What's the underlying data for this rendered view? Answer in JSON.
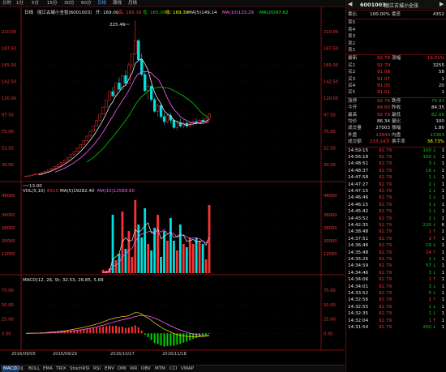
{
  "tabs": [
    "分时",
    "1分",
    "5分",
    "15分",
    "30分",
    "60分",
    "日线",
    "周线",
    "月线"
  ],
  "active_tab": "日线",
  "price_header": {
    "period": "日线",
    "name": "丽江古城小全张(6001003)",
    "open": "开: 169.00",
    "high": "高: 169.39",
    "low": "低: 165.00",
    "close": "收: 169.39",
    "ma5": "MA(5)149.14",
    "ma10": "MA(10)133.29",
    "ma20": "MA(20)97.62"
  },
  "vol_header": {
    "label": "VOL(5,10)",
    "v": "8510",
    "ma5": "MA(5)19282.40",
    "ma10": "MA(10)12589.60"
  },
  "macd_header": {
    "label": "MACD(12, 26, 9): 32.53, 26.85, 5.68"
  },
  "annotations": {
    "peak": "225.46",
    "low": "13.00"
  },
  "y_price_ticks": [
    "210.00",
    "187.50",
    "165.00",
    "142.50",
    "120.00",
    "97.50",
    "75.00",
    "52.50",
    "30.00"
  ],
  "y_vol_ticks": [
    "48000",
    "36000",
    "28000",
    "20000",
    "12000"
  ],
  "y_macd_ticks": [
    "75.00",
    "50.00",
    "25.00",
    "0.00"
  ],
  "x_dates": [
    "2016/09/05",
    "2016/09/29",
    "2016/10/27",
    "2016/11/18"
  ],
  "bottom_tabs": [
    "MACD",
    "KDJ",
    "BOLL",
    "EMA",
    "TRIX",
    "StochRSI",
    "RSI",
    "EMV",
    "DMI",
    "WR",
    "OBV",
    "MTM",
    "CCI",
    "VWAP"
  ],
  "active_bottom_tab": "MACD",
  "panel": {
    "code": "6001003",
    "name": "丽江古城小全张",
    "ratio_label": "委比",
    "ratio_value": "100.00%",
    "diff_label": "委差",
    "diff_value": "4352",
    "sells": [
      {
        "label": "卖5",
        "price": "",
        "qty": ""
      },
      {
        "label": "卖4",
        "price": "",
        "qty": ""
      },
      {
        "label": "卖3",
        "price": "",
        "qty": ""
      },
      {
        "label": "卖2",
        "price": "",
        "qty": ""
      },
      {
        "label": "卖1",
        "price": "",
        "qty": ""
      }
    ],
    "latest": {
      "label": "最新",
      "price": "92.79",
      "l2": "涨幅",
      "v2": "10.01%"
    },
    "buys": [
      {
        "label": "买1",
        "price": "92.79",
        "qty": "3255"
      },
      {
        "label": "买2",
        "price": "91.08",
        "qty": "58"
      },
      {
        "label": "买3",
        "price": "91.07",
        "qty": "1"
      },
      {
        "label": "买4",
        "price": "91.05",
        "qty": "20"
      },
      {
        "label": "买5",
        "price": "91.01",
        "qty": "1"
      }
    ],
    "stats": [
      {
        "l1": "涨停",
        "v1": "92.79",
        "c1": "red",
        "l2": "跌停",
        "v2": "75.91",
        "c2": "green"
      },
      {
        "l1": "今开",
        "v1": "84.60",
        "c1": "red",
        "l2": "昨收",
        "v2": "84.35",
        "c2": "white"
      },
      {
        "l1": "最高",
        "v1": "92.79",
        "c1": "red",
        "l2": "最低",
        "v2": "82.00",
        "c2": "green"
      },
      {
        "l1": "均价",
        "v1": "86.34",
        "c1": "white",
        "l2": "量比",
        "v2": "100",
        "c2": "white"
      },
      {
        "l1": "成交量",
        "v1": "27003",
        "c1": "white",
        "l2": "振幅",
        "v2": "1.86",
        "c2": "white"
      },
      {
        "l1": "外盘",
        "v1": "13640",
        "c1": "red",
        "l2": "内盘",
        "v2": "13363",
        "c2": "green"
      },
      {
        "l1": "成交额",
        "v1": "233.14万",
        "c1": "red",
        "l2": "换手率",
        "v2": "38.73%",
        "c2": "yellow"
      }
    ],
    "trades": [
      {
        "t": "14:59:15",
        "p": "92.79",
        "q": "100",
        "d": "down",
        "n": "1"
      },
      {
        "t": "14:56:18",
        "p": "92.79",
        "q": "100",
        "d": "down",
        "n": "1"
      },
      {
        "t": "14:48:51",
        "p": "92.79",
        "q": "3",
        "d": "down",
        "n": "1"
      },
      {
        "t": "14:48:37",
        "p": "92.79",
        "q": "16",
        "d": "down",
        "n": "1"
      },
      {
        "t": "14:47:58",
        "p": "92.79",
        "q": "1",
        "d": "down",
        "n": "1"
      },
      {
        "t": "14:47:27",
        "p": "92.79",
        "q": "2",
        "d": "down",
        "n": "1"
      },
      {
        "t": "14:47:15",
        "p": "92.79",
        "q": "1",
        "d": "down",
        "n": "1"
      },
      {
        "t": "14:46:46",
        "p": "92.79",
        "q": "1",
        "d": "down",
        "n": "1"
      },
      {
        "t": "14:46:15",
        "p": "92.79",
        "q": "1",
        "d": "down",
        "n": "1"
      },
      {
        "t": "14:45:42",
        "p": "92.79",
        "q": "1",
        "d": "down",
        "n": "1"
      },
      {
        "t": "14:43:52",
        "p": "92.79",
        "q": "2",
        "d": "down",
        "n": "1"
      },
      {
        "t": "14:42:35",
        "p": "92.79",
        "q": "220",
        "d": "down",
        "n": "6"
      },
      {
        "t": "14:38:48",
        "p": "92.79",
        "q": "1",
        "d": "up",
        "n": "1"
      },
      {
        "t": "14:37:51",
        "p": "92.79",
        "q": "3",
        "d": "up",
        "n": "1"
      },
      {
        "t": "14:36:46",
        "p": "92.79",
        "q": "19",
        "d": "down",
        "n": "1"
      },
      {
        "t": "14:35:48",
        "p": "92.79",
        "q": "24",
        "d": "up",
        "n": "1"
      },
      {
        "t": "14:35:26",
        "p": "92.79",
        "q": "1",
        "d": "down",
        "n": "1"
      },
      {
        "t": "14:34:59",
        "p": "92.79",
        "q": "57",
        "d": "down",
        "n": "1"
      },
      {
        "t": "14:34:46",
        "p": "92.79",
        "q": "3",
        "d": "down",
        "n": "1"
      },
      {
        "t": "14:34:06",
        "p": "92.79",
        "q": "1",
        "d": "up",
        "n": "1"
      },
      {
        "t": "14:34:01",
        "p": "92.79",
        "q": "3",
        "d": "down",
        "n": "1"
      },
      {
        "t": "14:33:52",
        "p": "92.79",
        "q": "5",
        "d": "down",
        "n": "1"
      },
      {
        "t": "14:32:56",
        "p": "92.79",
        "q": "1",
        "d": "up",
        "n": "1"
      },
      {
        "t": "14:32:55",
        "p": "92.79",
        "q": "1",
        "d": "down",
        "n": "1"
      },
      {
        "t": "14:32:35",
        "p": "92.79",
        "q": "1",
        "d": "down",
        "n": "1"
      },
      {
        "t": "14:32:04",
        "p": "92.79",
        "q": "1",
        "d": "up",
        "n": "1"
      },
      {
        "t": "14:31:54",
        "p": "92.79",
        "q": "200",
        "d": "down",
        "n": "1"
      }
    ]
  },
  "chart_data": {
    "type": "candlestick",
    "candles": [
      [
        14,
        14.5,
        13,
        14.2
      ],
      [
        14.2,
        15,
        14,
        14.8
      ],
      [
        14.8,
        16,
        14.5,
        15.8
      ],
      [
        15.8,
        17,
        15.5,
        16.9
      ],
      [
        16.9,
        18,
        16.5,
        17.5
      ],
      [
        17.5,
        19.5,
        17.2,
        19.2
      ],
      [
        19.2,
        21,
        19,
        20.8
      ],
      [
        20.8,
        23,
        20.5,
        22.9
      ],
      [
        22.9,
        25.2,
        22.5,
        25
      ],
      [
        25,
        27.5,
        24.5,
        27.3
      ],
      [
        27.3,
        30,
        27,
        29.8
      ],
      [
        29.8,
        33,
        29.5,
        32.8
      ],
      [
        32.8,
        36,
        32.5,
        35.9
      ],
      [
        35.9,
        39.5,
        35.5,
        39.4
      ],
      [
        39.4,
        43.3,
        39,
        43.2
      ],
      [
        43.2,
        47.5,
        43,
        47.4
      ],
      [
        47.4,
        52,
        47,
        51.9
      ],
      [
        51.9,
        57,
        51.5,
        56.8
      ],
      [
        56.8,
        62.5,
        56.5,
        62.4
      ],
      [
        62.4,
        68.5,
        62,
        68.4
      ],
      [
        68.4,
        75,
        68,
        74.9
      ],
      [
        74.9,
        82,
        74.5,
        81.9
      ],
      [
        81.9,
        90,
        81.5,
        89.8
      ],
      [
        89.8,
        98.5,
        89.5,
        98.4
      ],
      [
        98.4,
        108,
        98,
        107.8
      ],
      [
        107.8,
        118,
        107,
        117.5
      ],
      [
        117.5,
        129,
        117,
        128.8
      ],
      [
        128.8,
        135,
        121,
        123
      ],
      [
        123,
        141,
        122,
        140.5
      ],
      [
        140.5,
        148,
        130,
        132
      ],
      [
        132,
        152,
        131,
        150.5
      ],
      [
        150.5,
        158,
        138,
        140
      ],
      [
        140,
        168,
        139,
        165
      ],
      [
        165,
        181,
        160,
        180
      ],
      [
        180,
        225.46,
        178,
        198
      ],
      [
        198,
        200,
        170,
        172
      ],
      [
        172,
        180,
        150,
        152
      ],
      [
        152,
        156,
        128,
        130
      ],
      [
        130,
        140,
        118,
        136
      ],
      [
        136,
        138,
        115,
        118
      ],
      [
        118,
        120,
        100,
        102
      ],
      [
        102,
        112,
        95,
        110
      ],
      [
        110,
        112,
        92,
        95
      ],
      [
        95,
        100,
        84,
        88
      ],
      [
        88,
        98,
        86,
        96
      ],
      [
        96,
        100,
        86,
        90
      ],
      [
        90,
        92,
        78,
        80
      ],
      [
        80,
        90,
        76,
        86
      ],
      [
        86,
        92,
        80,
        82
      ],
      [
        82,
        89,
        79,
        86
      ],
      [
        86,
        88,
        80,
        82
      ],
      [
        82,
        88,
        80,
        86
      ],
      [
        86,
        90,
        82,
        88
      ],
      [
        88,
        92,
        84,
        86
      ],
      [
        86,
        92,
        85,
        90
      ],
      [
        90,
        93,
        87,
        88
      ],
      [
        88,
        94,
        86,
        92
      ],
      [
        92,
        100,
        90,
        98
      ]
    ],
    "volumes": [
      0,
      0,
      0,
      0,
      0,
      0,
      0,
      0,
      0,
      0,
      0,
      0,
      0,
      0,
      0,
      0,
      0,
      0,
      0,
      0,
      0,
      0,
      0,
      0,
      2100,
      1500,
      3000,
      36000,
      8000,
      12000,
      38000,
      15000,
      26000,
      10000,
      45000,
      30000,
      22000,
      40000,
      18000,
      14000,
      28000,
      36000,
      10000,
      26000,
      20000,
      34000,
      20000,
      14000,
      30000,
      18000,
      16000,
      22000,
      18000,
      22000,
      20000,
      18000,
      8510,
      42000
    ],
    "macd": [
      0,
      0,
      0,
      0,
      0,
      0,
      0,
      0,
      0,
      0,
      0,
      0,
      0,
      0,
      0,
      0,
      0,
      0,
      0,
      0,
      0,
      0,
      0,
      0,
      0,
      0,
      0,
      0,
      0,
      0,
      0,
      0,
      0,
      0,
      0,
      0,
      -1,
      -3,
      -6,
      -8,
      -10,
      -12,
      -13,
      -14,
      -15,
      -14,
      -13,
      -12,
      -10,
      -9,
      -8,
      -7,
      -6,
      -5,
      -4,
      -3,
      -2,
      -1
    ],
    "xlim": [
      "2016/09/05",
      "2016/11/18"
    ]
  }
}
